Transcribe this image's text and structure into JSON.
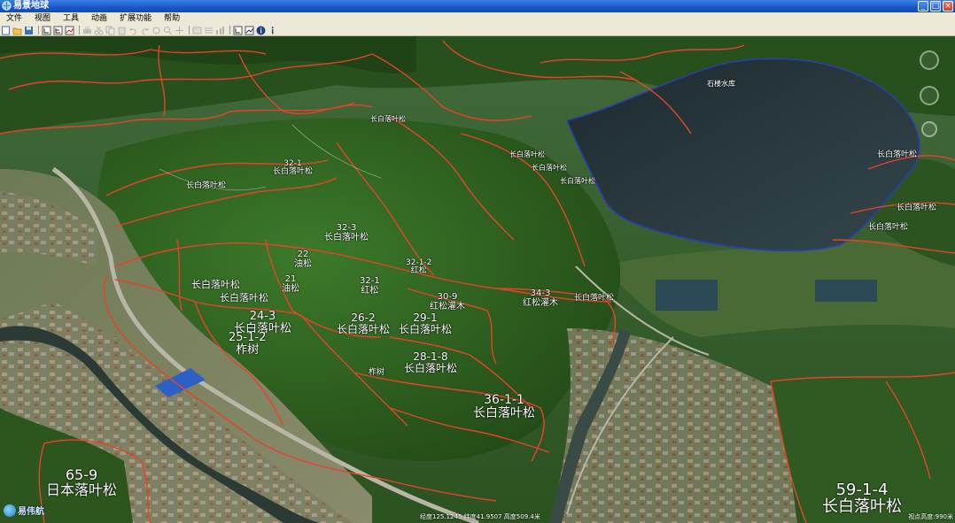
{
  "window": {
    "title": "易景地球"
  },
  "menu": [
    {
      "label": "文件"
    },
    {
      "label": "视图"
    },
    {
      "label": "工具"
    },
    {
      "label": "动画"
    },
    {
      "label": "扩展功能"
    },
    {
      "label": "帮助"
    }
  ],
  "map": {
    "reservoir_label": "石楼水库",
    "stand_labels": [
      {
        "code": "",
        "species": "长白落叶松"
      },
      {
        "code": "",
        "species": "长白落叶松"
      },
      {
        "code": "",
        "species": "长白落叶松"
      },
      {
        "code": "",
        "species": "长白落叶松"
      },
      {
        "code": "",
        "species": "长白落叶松"
      },
      {
        "code": "32-1",
        "species": "长白落叶松"
      },
      {
        "code": "",
        "species": "长白落叶松"
      },
      {
        "code": "",
        "species": "长白落叶松"
      },
      {
        "code": "",
        "species": "长白落叶松"
      },
      {
        "code": "32-3",
        "species": "长白落叶松"
      },
      {
        "code": "22",
        "species": "油松"
      },
      {
        "code": "32-1-2",
        "species": "红松"
      },
      {
        "code": "21",
        "species": "油松"
      },
      {
        "code": "32-1",
        "species": "红松"
      },
      {
        "code": "34-3",
        "species": "红松灌木"
      },
      {
        "code": "30-9",
        "species": "红松灌木"
      },
      {
        "code": "",
        "species": "长白落叶松"
      },
      {
        "code": "",
        "species": "长白落叶松"
      },
      {
        "code": "",
        "species": "长白落叶松"
      },
      {
        "code": "24-3",
        "species": "长白落叶松"
      },
      {
        "code": "26-2",
        "species": "长白落叶松"
      },
      {
        "code": "29-1",
        "species": "长白落叶松"
      },
      {
        "code": "25-1-2",
        "species": "柞树"
      },
      {
        "code": "28-1-8",
        "species": "长白落叶松"
      },
      {
        "code": "",
        "species": "柞树"
      },
      {
        "code": "36-1-1",
        "species": "长白落叶松"
      },
      {
        "code": "65-9",
        "species": "日本落叶松"
      },
      {
        "code": "59-1-4",
        "species": "长白落叶松"
      }
    ]
  },
  "status": {
    "coords": "经度125.1245  纬度41.9507  高度509.4米",
    "altitude": "视点高度:990米"
  },
  "branding": {
    "logo_text": "易伟航"
  },
  "colors": {
    "boundary": "#e8432a",
    "water": "#28363d",
    "shoreline": "#2a3fb0",
    "forest": "#2f5a22",
    "titlebar": "#1a56c9"
  }
}
